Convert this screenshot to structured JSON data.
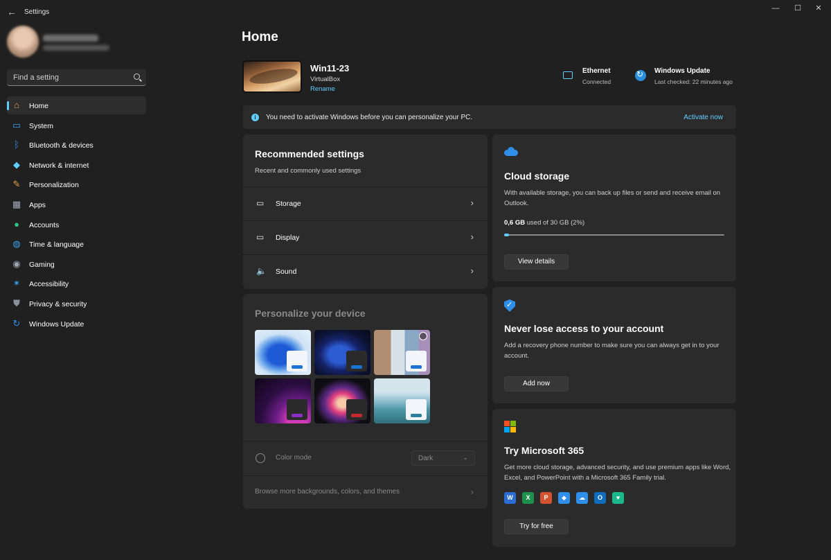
{
  "window": {
    "title": "Settings"
  },
  "sidebar": {
    "search_placeholder": "Find a setting",
    "items": [
      {
        "label": "Home",
        "icon": "home-icon",
        "color": "#e8a14b"
      },
      {
        "label": "System",
        "icon": "system-icon",
        "color": "#3aa0e6"
      },
      {
        "label": "Bluetooth & devices",
        "icon": "bluetooth-icon",
        "color": "#2f8fe8"
      },
      {
        "label": "Network & internet",
        "icon": "wifi-icon",
        "color": "#60cdff"
      },
      {
        "label": "Personalization",
        "icon": "brush-icon",
        "color": "#e8a14b"
      },
      {
        "label": "Apps",
        "icon": "apps-icon",
        "color": "#a0a8b8"
      },
      {
        "label": "Accounts",
        "icon": "person-icon",
        "color": "#2fbf8a"
      },
      {
        "label": "Time & language",
        "icon": "globe-icon",
        "color": "#3aa0e6"
      },
      {
        "label": "Gaming",
        "icon": "gamepad-icon",
        "color": "#a0a8b8"
      },
      {
        "label": "Accessibility",
        "icon": "accessibility-icon",
        "color": "#3aa0e6"
      },
      {
        "label": "Privacy & security",
        "icon": "shield-icon",
        "color": "#8a8f99"
      },
      {
        "label": "Windows Update",
        "icon": "update-icon",
        "color": "#2f8fe8"
      }
    ]
  },
  "main": {
    "title": "Home",
    "device": {
      "name": "Win11-23",
      "model": "VirtualBox",
      "rename": "Rename"
    },
    "status": {
      "ethernet": {
        "title": "Ethernet",
        "sub": "Connected"
      },
      "update": {
        "title": "Windows Update",
        "sub": "Last checked: 22 minutes ago"
      }
    },
    "banner": {
      "text": "You need to activate Windows before you can personalize your PC.",
      "link": "Activate now"
    },
    "recommended": {
      "title": "Recommended settings",
      "subtitle": "Recent and commonly used settings",
      "rows": [
        {
          "label": "Storage",
          "icon": "storage-icon"
        },
        {
          "label": "Display",
          "icon": "display-icon"
        },
        {
          "label": "Sound",
          "icon": "speaker-icon"
        }
      ]
    },
    "personalize": {
      "title": "Personalize your device",
      "color_mode_label": "Color mode",
      "color_mode_value": "Dark",
      "browse": "Browse more backgrounds, colors, and themes"
    },
    "cloud": {
      "title": "Cloud storage",
      "desc": "With available storage, you can back up files or send and receive email on Outlook.",
      "used": "0,6 GB",
      "total_text": "used of 30 GB (2%)",
      "used_fraction": 0.02,
      "button": "View details"
    },
    "account": {
      "title": "Never lose access to your account",
      "desc": "Add a recovery phone number to make sure you can always get in to your account.",
      "button": "Add now"
    },
    "m365": {
      "title": "Try Microsoft 365",
      "desc": "Get more cloud storage, advanced security, and use premium apps like Word, Excel, and PowerPoint with a Microsoft 365 Family trial.",
      "button": "Try for free",
      "apps": [
        {
          "icon": "word-icon",
          "color": "#2b6cd4",
          "glyph": "W"
        },
        {
          "icon": "excel-icon",
          "color": "#1f8f4d",
          "glyph": "X"
        },
        {
          "icon": "powerpoint-icon",
          "color": "#d35230",
          "glyph": "P"
        },
        {
          "icon": "defender-icon",
          "color": "#2f8fe8",
          "glyph": "◆"
        },
        {
          "icon": "onedrive-icon",
          "color": "#2f8fe8",
          "glyph": "☁"
        },
        {
          "icon": "outlook-icon",
          "color": "#0f6cbd",
          "glyph": "O"
        },
        {
          "icon": "family-icon",
          "color": "#1bb68a",
          "glyph": "♥"
        }
      ]
    }
  },
  "colors": {
    "accent": "#60cdff",
    "background": "#202020",
    "card": "#2b2b2b"
  }
}
